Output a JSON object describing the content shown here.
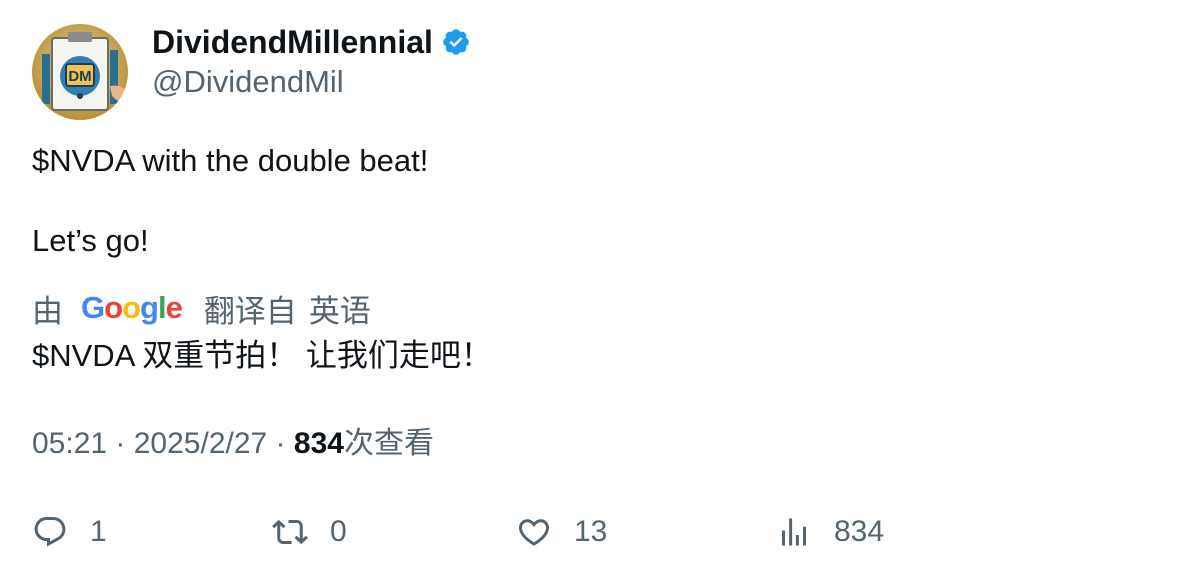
{
  "author": {
    "name": "DividendMillennial",
    "handle": "@DividendMil",
    "avatar_text": "DM"
  },
  "tweet": {
    "lines": [
      "$NVDA with the double beat!",
      "Let’s go!"
    ]
  },
  "translation": {
    "by_label": "由",
    "provider": "Google",
    "from_label": "翻译自",
    "language": "英语",
    "text": "$NVDA 双重节拍！ 让我们走吧！"
  },
  "meta": {
    "time": "05:21",
    "separator": " · ",
    "date": "2025/2/27",
    "views_count": "834",
    "views_label": "次查看"
  },
  "actions": {
    "replies": "1",
    "retweets": "0",
    "likes": "13",
    "views": "834"
  },
  "colors": {
    "text": "#0f1419",
    "secondary": "#536471",
    "verified": "#1d9bf0",
    "google_blue": "#4285F4",
    "google_red": "#EA4335",
    "google_yellow": "#FBBC05",
    "google_green": "#34A853"
  }
}
